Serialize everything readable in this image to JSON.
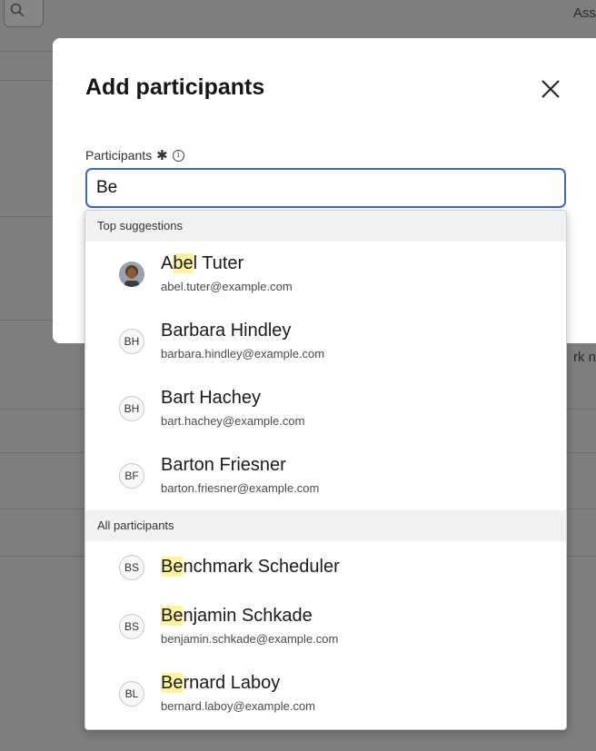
{
  "background": {
    "top_right_text": "Ass",
    "side_text": "rk n"
  },
  "modal": {
    "title": "Add participants",
    "field_label": "Participants",
    "required_mark": "✱",
    "info_mark": "i",
    "input_value": "Be"
  },
  "dropdown": {
    "sections": [
      {
        "header": "Top suggestions",
        "items": [
          {
            "name_pre": "A",
            "name_match": "be",
            "name_post": "l Tuter",
            "email": "abel.tuter@example.com",
            "initials": "",
            "photo": true
          },
          {
            "name_pre": "Barbara Hindley",
            "name_match": "",
            "name_post": "",
            "email": "barbara.hindley@example.com",
            "initials": "BH"
          },
          {
            "name_pre": "Bart Hachey",
            "name_match": "",
            "name_post": "",
            "email": "bart.hachey@example.com",
            "initials": "BH"
          },
          {
            "name_pre": "Barton Friesner",
            "name_match": "",
            "name_post": "",
            "email": "barton.friesner@example.com",
            "initials": "BF"
          }
        ]
      },
      {
        "header": "All participants",
        "items": [
          {
            "name_pre": "",
            "name_match": "Be",
            "name_post": "nchmark Scheduler",
            "email": "",
            "initials": "BS"
          },
          {
            "name_pre": "",
            "name_match": "Be",
            "name_post": "njamin Schkade",
            "email": "benjamin.schkade@example.com",
            "initials": "BS"
          },
          {
            "name_pre": "",
            "name_match": "Be",
            "name_post": "rnard Laboy",
            "email": "bernard.laboy@example.com",
            "initials": "BL"
          }
        ]
      }
    ]
  },
  "colors": {
    "focus_border": "#3b67c9",
    "highlight": "#fff2a0",
    "overlay": "#7e7e7e"
  }
}
